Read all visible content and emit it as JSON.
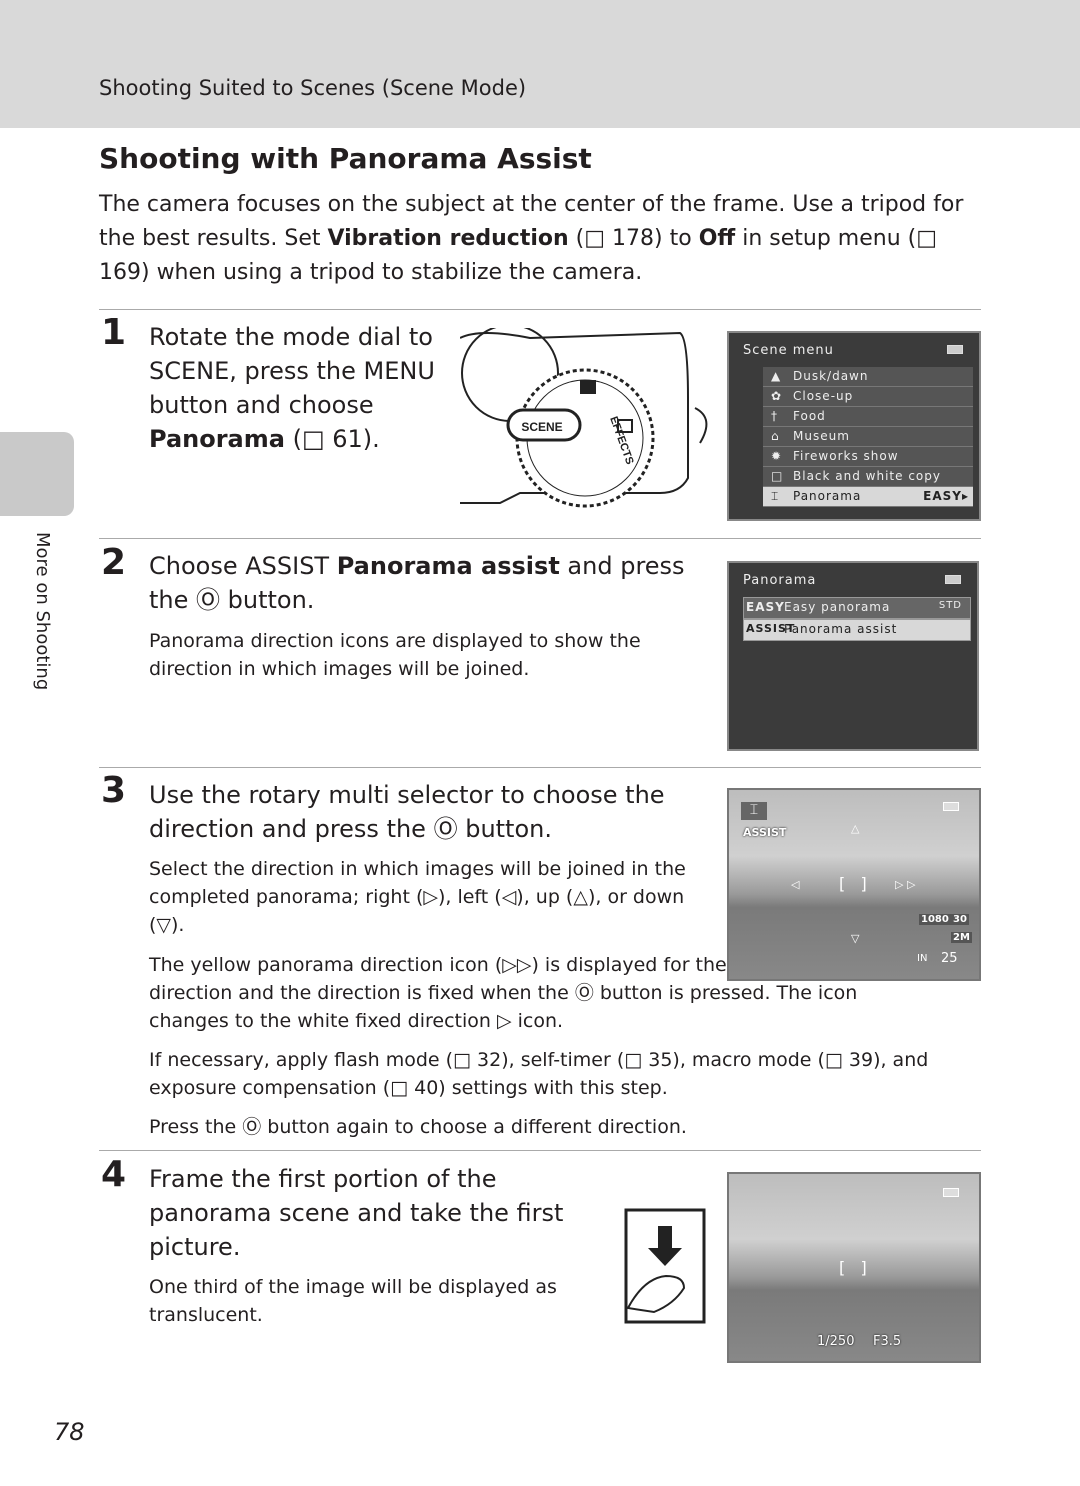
{
  "header": {
    "section": "Shooting Suited to Scenes (Scene Mode)"
  },
  "title": "Shooting with Panorama Assist",
  "intro": {
    "text1": "The camera focuses on the subject at the center of the frame. Use a tripod for the best results. Set ",
    "bold1": "Vibration reduction",
    "text2": " (□ 178) to ",
    "bold2": "Off",
    "text3": " in setup menu (□ 169) when using a tripod to stabilize the camera."
  },
  "side_label": "More on Shooting",
  "page_number": "78",
  "steps": [
    {
      "num": "1",
      "heading_a": "Rotate the mode dial to SCENE, press the MENU button and choose ",
      "heading_bold": "Panorama",
      "heading_b": " (□ 61)."
    },
    {
      "num": "2",
      "heading_a": "Choose ASSIST ",
      "heading_bold": "Panorama assist",
      "heading_b": " and press the Ⓞ button.",
      "para": "Panorama direction icons are displayed to show the direction in which images will be joined."
    },
    {
      "num": "3",
      "heading": "Use the rotary multi selector to choose the direction and press the Ⓞ button.",
      "para1": "Select the direction in which images will be joined in the completed panorama; right (▷), left (◁), up (△), or down (▽).",
      "para2": "The yellow panorama direction icon (▷▷) is displayed for the current direction and the direction is fixed when the Ⓞ button is pressed. The icon changes to the white fixed direction ▷ icon.",
      "para3": "If necessary, apply flash mode (□ 32), self-timer (□ 35), macro mode (□ 39), and exposure compensation (□ 40) settings with this step.",
      "para4": "Press the Ⓞ button again to choose a different direction."
    },
    {
      "num": "4",
      "heading": "Frame the first portion of the panorama scene and take the first picture.",
      "para": "One third of the image will be displayed as translucent."
    }
  ],
  "scene_menu": {
    "title": "Scene menu",
    "items": [
      {
        "icon": "dusk-dawn-icon",
        "glyph": "▲",
        "label": "Dusk/dawn"
      },
      {
        "icon": "close-up-icon",
        "glyph": "✿",
        "label": "Close-up"
      },
      {
        "icon": "food-icon",
        "glyph": "†",
        "label": "Food"
      },
      {
        "icon": "museum-icon",
        "glyph": "⌂",
        "label": "Museum"
      },
      {
        "icon": "fireworks-icon",
        "glyph": "✹",
        "label": "Fireworks show"
      },
      {
        "icon": "copy-icon",
        "glyph": "□",
        "label": "Black and white copy"
      },
      {
        "icon": "panorama-icon",
        "glyph": "⌶",
        "label": "Panorama",
        "value": "EASY▸"
      }
    ]
  },
  "panorama_menu": {
    "title": "Panorama",
    "items": [
      {
        "tag": "EASY",
        "label": "Easy panorama",
        "value": "STD"
      },
      {
        "tag": "ASSIST",
        "label": "Panorama assist"
      }
    ]
  },
  "monitor3": {
    "mode": "ASSIST",
    "res": "1080",
    "fps": "30",
    "size": "2M",
    "storage": "IN",
    "count": "25"
  },
  "monitor4": {
    "shutter": "1/250",
    "aperture": "F3.5"
  },
  "dial": {
    "label": "SCENE",
    "effects": "EFFECTS"
  }
}
